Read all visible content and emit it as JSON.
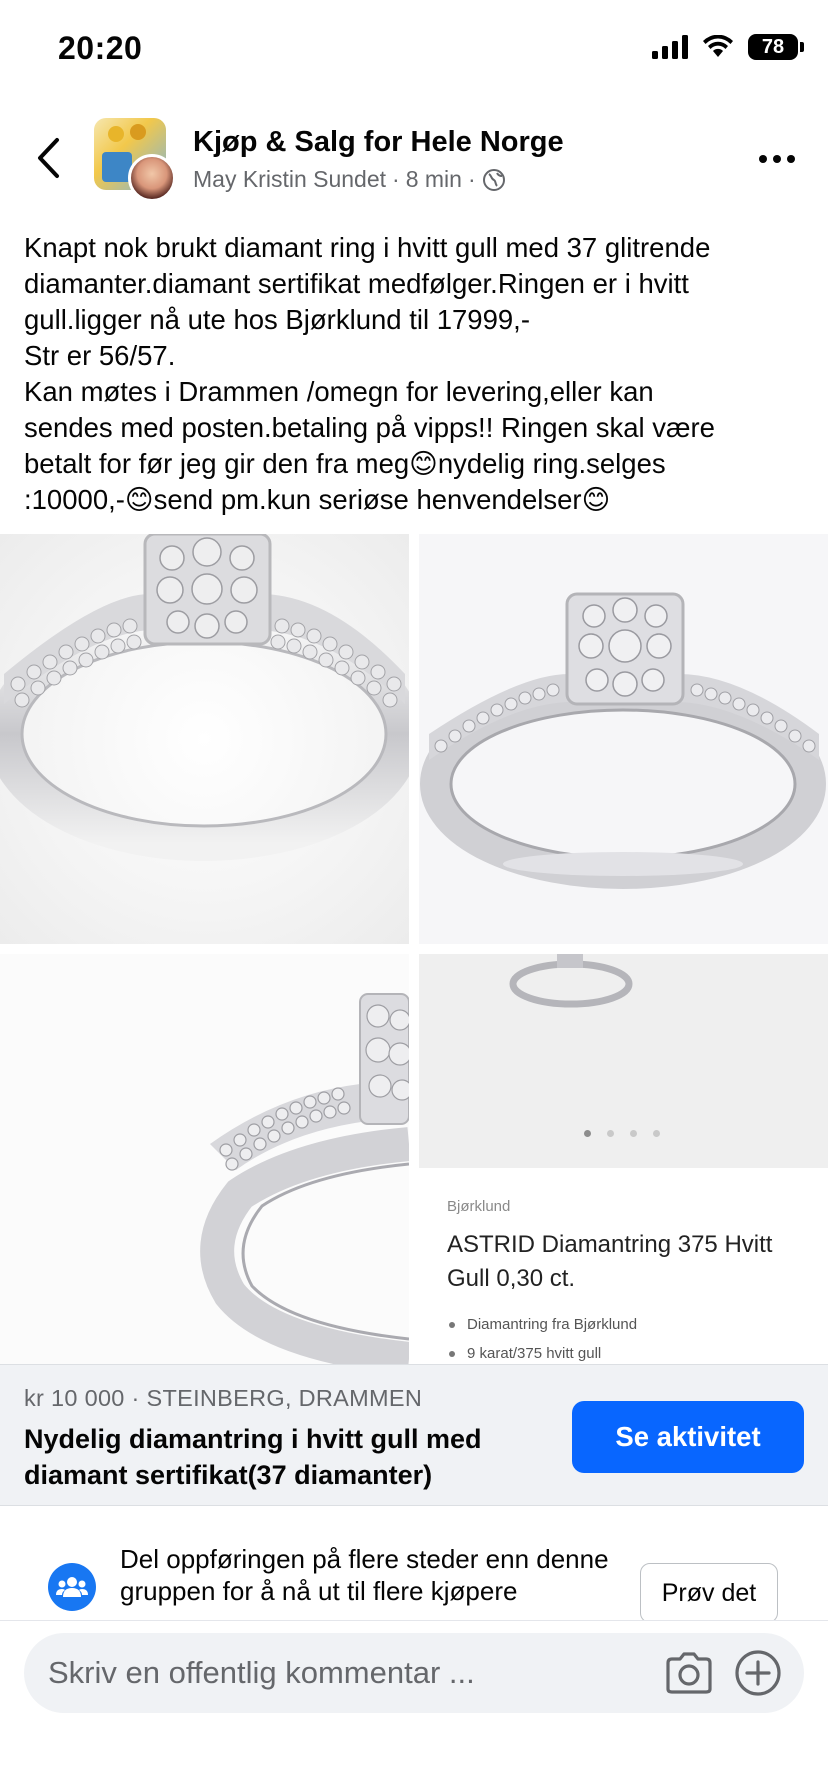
{
  "status_bar": {
    "time": "20:20",
    "battery": "78"
  },
  "header": {
    "group_name": "Kjøp & Salg for Hele Norge",
    "author": "May Kristin Sundet",
    "separator": "·",
    "time_ago": "8 min",
    "privacy_icon": "globe-icon"
  },
  "post": {
    "lines": [
      "Knapt nok brukt diamant ring i hvitt gull med 37 glitrende",
      "diamanter.diamant sertifikat medfølger.Ringen er i hvitt",
      "gull.ligger nå ute hos Bjørklund til 17999,-",
      "Str er 56/57.",
      "Kan møtes i Drammen /omegn for levering,eller kan",
      "sendes med posten.betaling på vipps!! Ringen skal være",
      "betalt for før jeg gir den fra meg😊nydelig ring.selges",
      ":10000,-😊send pm.kun seriøse henvendelser😊"
    ]
  },
  "photo_4": {
    "brand": "Bjørklund",
    "title": "ASTRID Diamantring 375 Hvitt Gull 0,30 ct.",
    "bullets": [
      "Diamantring fra Bjørklund",
      "9 karat/375 hvitt gull"
    ]
  },
  "listing": {
    "price_location": "kr 10 000 · STEINBERG, DRAMMEN",
    "title": "Nydelig diamantring i hvitt gull med diamant sertifikat(37 diamanter)",
    "button": "Se aktivitet"
  },
  "share": {
    "text": "Del oppføringen på flere steder enn denne gruppen for å nå ut til flere kjøpere",
    "button": "Prøv det"
  },
  "composer": {
    "placeholder": "Skriv en offentlig kommentar ..."
  },
  "colors": {
    "accent": "#0866ff",
    "secondary_text": "#65676b",
    "listing_bg": "#f0f2f5"
  }
}
